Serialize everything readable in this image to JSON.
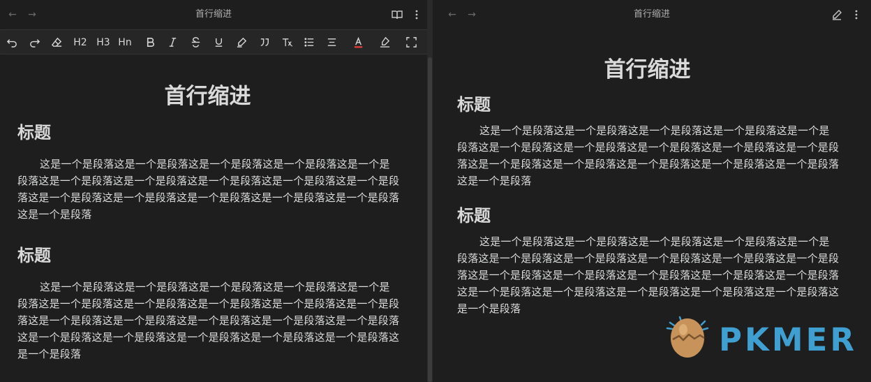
{
  "left_view": {
    "title": "首行缩进",
    "doc_title": "首行缩进",
    "toolbar": {
      "h2": "H2",
      "h3": "H3",
      "hn": "Hn"
    },
    "sections": [
      {
        "heading": "标题",
        "paragraph": "这是一个是段落这是一个是段落这是一个是段落这是一个是段落这是一个是段落这是一个是段落这是一个是段落这是一个是段落这是一个是段落这是一个是段落这是一个是段落这是一个是段落这是一个是段落这是一个是段落这是一个是段落这是一个是段落"
      },
      {
        "heading": "标题",
        "paragraph": "这是一个是段落这是一个是段落这是一个是段落这是一个是段落这是一个是段落这是一个是段落这是一个是段落这是一个是段落这是一个是段落这是一个是段落这是一个是段落这是一个是段落这是一个是段落这是一个是段落这是一个是段落这是一个是段落这是一个是段落这是一个是段落这是一个是段落这是一个是段落这是一个是段落"
      }
    ]
  },
  "right_view": {
    "title": "首行缩进",
    "doc_title": "首行缩进",
    "sections": [
      {
        "heading": "标题",
        "paragraph": "这是一个是段落这是一个是段落这是一个是段落这是一个是段落这是一个是段落这是一个是段落这是一个是段落这是一个是段落这是一个是段落这是一个是段落这是一个是段落这是一个是段落这是一个是段落这是一个是段落这是一个是段落这是一个是段落"
      },
      {
        "heading": "标题",
        "paragraph": "这是一个是段落这是一个是段落这是一个是段落这是一个是段落这是一个是段落这是一个是段落这是一个是段落这是一个是段落这是一个是段落这是一个是段落这是一个是段落这是一个是段落这是一个是段落这是一个是段落这是一个是段落这是一个是段落这是一个是段落这是一个是段落这是一个是段落这是一个是段落这是一个是段落"
      }
    ]
  },
  "watermark": {
    "text": "PKMER"
  },
  "colors": {
    "background": "#1e1e1e",
    "text": "#dcddde",
    "font_color_underline": "#e03c3c",
    "pkmer_blue": "#3f9fd0",
    "pkmer_logo": "#c8935a"
  }
}
